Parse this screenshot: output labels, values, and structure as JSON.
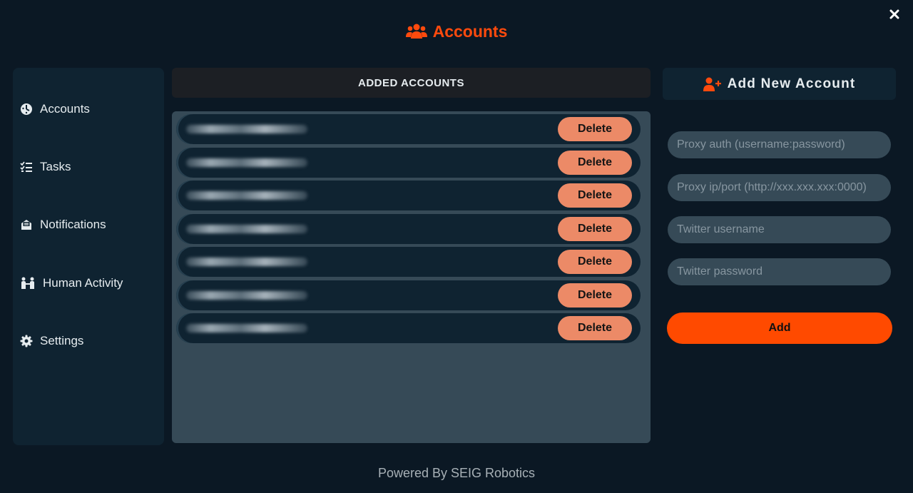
{
  "window": {
    "close_icon": "close-icon"
  },
  "header": {
    "title": "Accounts",
    "icon": "users-icon",
    "accent": "#ff4a0d"
  },
  "sidebar": {
    "items": [
      {
        "label": "Accounts",
        "icon": "dashboard-icon"
      },
      {
        "label": "Tasks",
        "icon": "checklist-icon"
      },
      {
        "label": "Notifications",
        "icon": "envelope-icon"
      },
      {
        "label": "Human Activity",
        "icon": "people-icon"
      },
      {
        "label": "Settings",
        "icon": "gear-icon"
      }
    ]
  },
  "added_accounts": {
    "title": "ADDED ACCOUNTS",
    "delete_label": "Delete",
    "rows": [
      "",
      "",
      "",
      "",
      "",
      "",
      ""
    ]
  },
  "add_form": {
    "title": "Add New Account",
    "icon": "user-plus-icon",
    "proxy_auth_placeholder": "Proxy auth (username:password)",
    "proxy_ip_placeholder": "Proxy ip/port (http://xxx.xxx.xxx:0000)",
    "twitter_username_placeholder": "Twitter username",
    "twitter_password_placeholder": "Twitter password",
    "add_label": "Add"
  },
  "footer": {
    "text": "Powered By SEIG Robotics"
  }
}
